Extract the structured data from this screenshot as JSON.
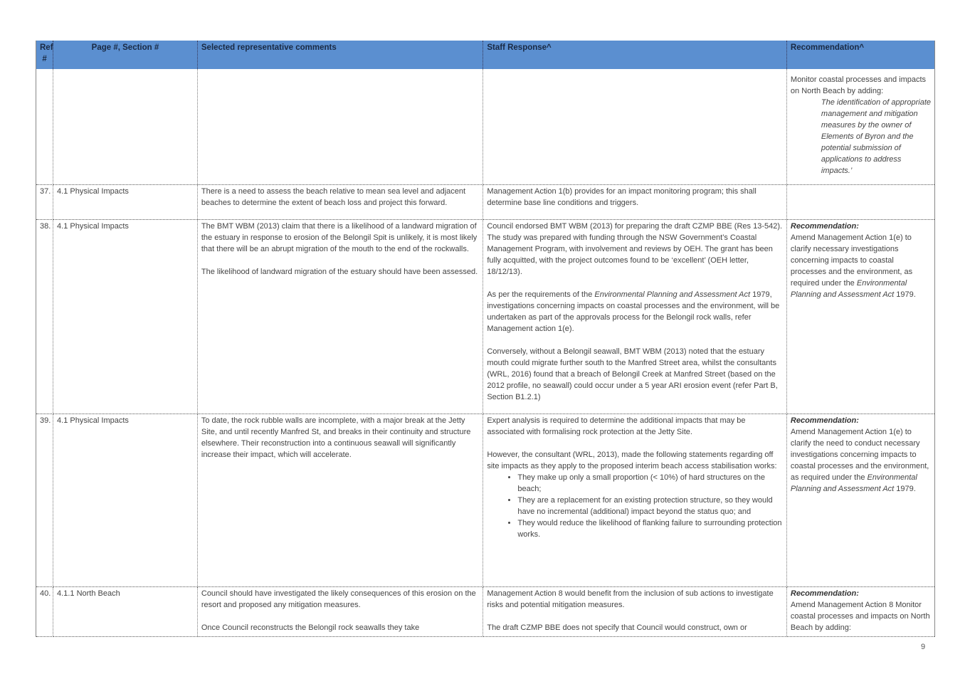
{
  "table": {
    "headers": {
      "ref": "Ref #",
      "page": "Page #, Section #",
      "comments": "Selected representative comments",
      "staff": "Staff Response^",
      "recommendation": "Recommendation^"
    },
    "cont": {
      "rec_intro": "Monitor coastal processes and impacts on North Beach by adding:",
      "rec_quote": "The identification of appropriate management and mitigation measures by the owner of Elements of Byron and the potential submission of applications to address impacts.’"
    },
    "r37": {
      "ref": "37.",
      "page": "4.1 Physical Impacts",
      "comment": "There is a need to assess the beach relative to mean sea level and adjacent beaches to determine the extent of beach loss and project this forward.",
      "staff": "Management Action 1(b) provides for an impact monitoring program; this shall determine base line conditions and triggers."
    },
    "r38": {
      "ref": "38.",
      "page": "4.1 Physical Impacts",
      "comment_1": "The BMT WBM (2013) claim that there is a likelihood of a landward migration of the estuary in response to erosion of the Belongil Spit is unlikely, it is most likely that there will be an abrupt migration of the mouth to the end of the rockwalls.",
      "comment_2": "The likelihood of landward migration of the estuary should have been assessed.",
      "staff_1": "Council endorsed BMT WBM (2013) for preparing the draft CZMP BBE (Res 13-542). The study was prepared with funding through the NSW Government’s Coastal Management Program, with involvement and reviews by OEH. The grant has been fully acquitted, with the project outcomes found to be ‘excellent’ (OEH letter, 18/12/13).",
      "staff_2a": "As per the requirements of the ",
      "staff_2_italic": "Environmental Planning and Assessment Act",
      "staff_2b": " 1979, investigations concerning impacts on coastal processes and the environment, will be undertaken as part of the approvals process for the Belongil rock walls, refer Management action 1(e).",
      "staff_3": "Conversely, without a Belongil seawall, BMT WBM (2013) noted that the estuary mouth could migrate further south to the Manfred Street area, whilst the consultants (WRL, 2016) found that a breach of Belongil Creek at Manfred Street (based on the 2012 profile, no seawall) could occur under a 5 year ARI erosion event (refer Part B, Section B1.2.1)",
      "rec_head": "Recommendation:",
      "rec_a": "Amend Management Action 1(e) to clarify necessary investigations concerning impacts to coastal processes and the environment, as required under the ",
      "rec_italic": "Environmental Planning and Assessment Act",
      "rec_b": " 1979."
    },
    "r39": {
      "ref": "39.",
      "page": "4.1 Physical Impacts",
      "comment": "To date, the rock rubble walls are incomplete, with a major break at the Jetty Site, and until recently Manfred St, and breaks in their continuity and structure elsewhere. Their reconstruction into a continuous seawall will significantly increase their impact, which will accelerate.",
      "staff_1": "Expert analysis is required to determine the additional impacts that may be associated with formalising rock protection at the Jetty Site.",
      "staff_2": "However, the consultant (WRL, 2013), made the following statements regarding off site impacts as they apply to the proposed interim beach access stabilisation works:",
      "bullets": [
        "They make up only a small proportion (< 10%) of hard structures on the beach;",
        "They are a replacement for an existing protection structure, so they would have no incremental (additional) impact beyond the status quo; and",
        "They would reduce the likelihood of flanking failure to surrounding protection works."
      ],
      "rec_head": "Recommendation:",
      "rec_a": "Amend Management Action 1(e) to clarify the need to conduct necessary investigations concerning impacts to coastal processes and the environment, as required under the ",
      "rec_italic": "Environmental Planning and Assessment Act",
      "rec_b": " 1979."
    },
    "r40": {
      "ref": "40.",
      "page": "4.1.1 North Beach",
      "comment_1": "Council should have investigated the likely consequences of this erosion on the resort and proposed any mitigation measures.",
      "comment_2": "Once Council reconstructs the Belongil rock seawalls they take",
      "staff_1": "Management Action 8 would benefit from the inclusion of sub actions to investigate risks and potential mitigation measures.",
      "staff_2": "The draft CZMP BBE does not specify that Council would construct, own or",
      "rec_head": "Recommendation:",
      "rec_text": "Amend Management Action 8 Monitor coastal processes and impacts on North Beach by adding:"
    }
  },
  "footer": {
    "page_number": "9"
  }
}
